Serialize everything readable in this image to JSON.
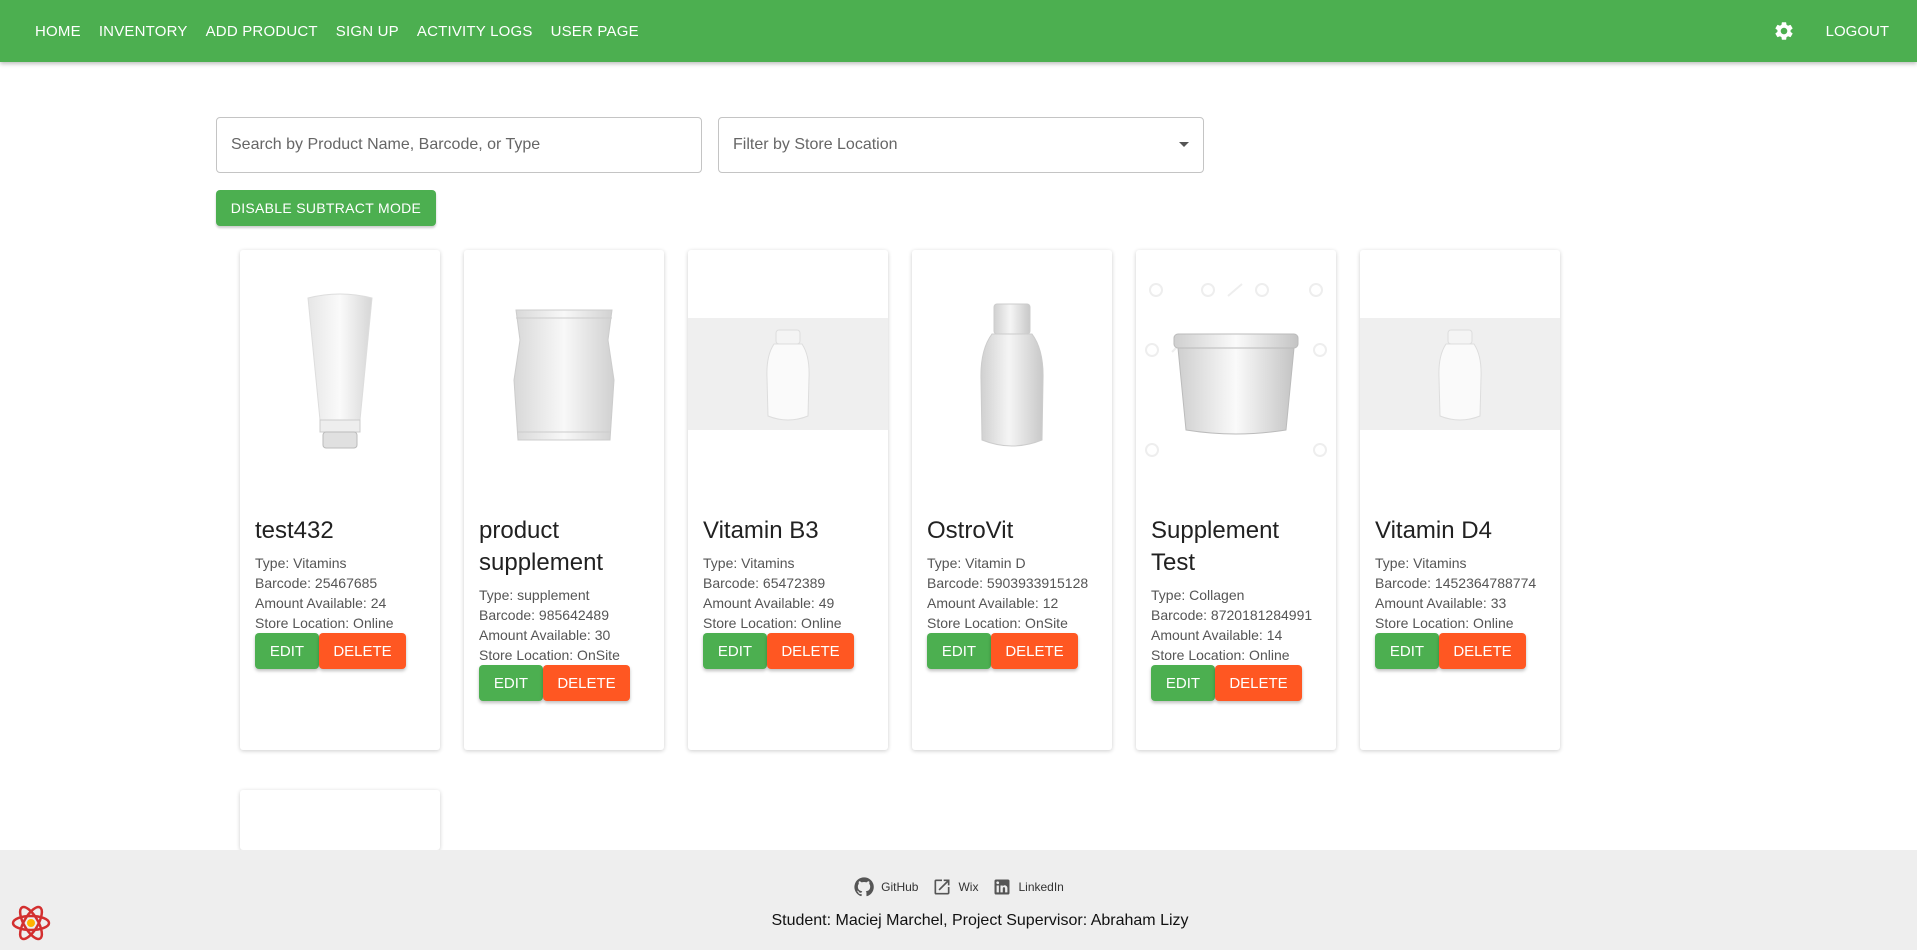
{
  "nav": {
    "items": [
      "HOME",
      "INVENTORY",
      "ADD PRODUCT",
      "SIGN UP",
      "ACTIVITY LOGS",
      "USER PAGE"
    ],
    "logout": "LOGOUT",
    "brand_color": "#4caf50"
  },
  "search": {
    "placeholder": "Search by Product Name, Barcode, or Type",
    "filter_placeholder": "Filter by Store Location"
  },
  "mode_button": "DISABLE SUBTRACT MODE",
  "products": [
    {
      "name": "test432",
      "type": "Type: Vitamins",
      "barcode": "Barcode: 25467685",
      "amount": "Amount Available: 24",
      "location": "Store Location: Online",
      "image": "tube-icon"
    },
    {
      "name": "product supplement",
      "type": "Type: supplement",
      "barcode": "Barcode: 985642489",
      "amount": "Amount Available: 30",
      "location": "Store Location: OnSite",
      "image": "pouch-icon"
    },
    {
      "name": "Vitamin B3",
      "type": "Type: Vitamins",
      "barcode": "Barcode: 65472389",
      "amount": "Amount Available: 49",
      "location": "Store Location: Online",
      "image": "bottle-icon"
    },
    {
      "name": "OstroVit",
      "type": "Type: Vitamin D",
      "barcode": "Barcode: 5903933915128",
      "amount": "Amount Available: 12",
      "location": "Store Location: OnSite",
      "image": "bottle-icon"
    },
    {
      "name": "Supplement Test",
      "type": "Type: Collagen",
      "barcode": "Barcode: 8720181284991",
      "amount": "Amount Available: 14",
      "location": "Store Location: Online",
      "image": "tub-icon"
    },
    {
      "name": "Vitamin D4",
      "type": "Type: Vitamins",
      "barcode": "Barcode: 1452364788774",
      "amount": "Amount Available: 33",
      "location": "Store Location: Online",
      "image": "bottle-icon"
    }
  ],
  "buttons": {
    "edit": "EDIT",
    "delete": "DELETE",
    "edit_color": "#4caf50",
    "delete_color": "#ff5722"
  },
  "footer": {
    "links": [
      "GitHub",
      "Wix",
      "LinkedIn"
    ],
    "credits": "Student: Maciej Marchel, Project Supervisor: Abraham Lizy"
  }
}
